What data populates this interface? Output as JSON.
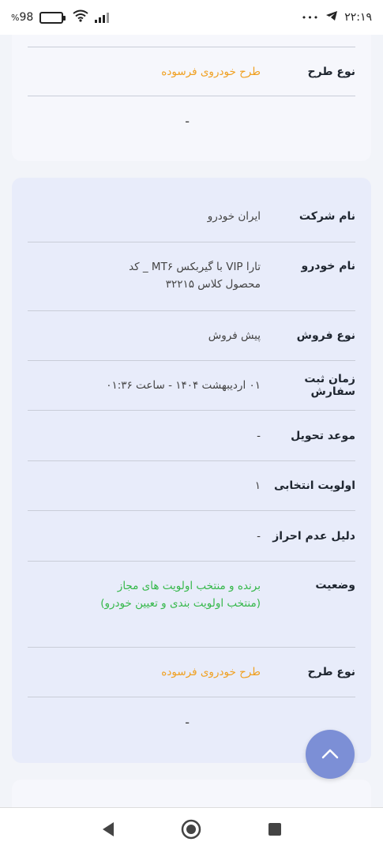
{
  "status_bar": {
    "battery": "98",
    "battery_suffix": "%",
    "time": "۲۲:۱۹",
    "dots": "•••"
  },
  "card_prev": {
    "rows": [
      {
        "label": "نوع طرح",
        "value": "طرح خودروی فرسوده"
      },
      {
        "label": "",
        "value": "-"
      }
    ]
  },
  "card_main": {
    "rows": [
      {
        "label": "نام شرکت",
        "value": "ایران خودرو"
      },
      {
        "label": "نام خودرو",
        "value": "تارا VIP با گیربکس MT۶ _ کد محصول کلاس ۳۲۲۱۵"
      },
      {
        "label": "نوع فروش",
        "value": "پیش فروش"
      },
      {
        "label": "زمان ثبت سفارش",
        "value": "۰۱ اردیبهشت ۱۴۰۴ - ساعت ۰۱:۳۶"
      },
      {
        "label": "موعد تحویل",
        "value": "-"
      },
      {
        "label": "اولویت انتخابی",
        "value": "۱"
      },
      {
        "label": "دلیل عدم احراز",
        "value": "-"
      },
      {
        "label": "وضعیت",
        "value": "برنده و منتخب اولویت های مجاز (منتخب اولویت بندی و تعیین خودرو)"
      },
      {
        "label": "نوع طرح",
        "value": "طرح خودروی فرسوده"
      },
      {
        "label": "",
        "value": "-"
      }
    ]
  },
  "colors": {
    "orange": "#f0a020",
    "green": "#35b84a",
    "fab": "#7c8fd6"
  },
  "icons": {
    "fab": "chevron-up-icon",
    "back": "back-triangle-icon",
    "home": "home-circle-icon",
    "recents": "recents-square-icon"
  }
}
